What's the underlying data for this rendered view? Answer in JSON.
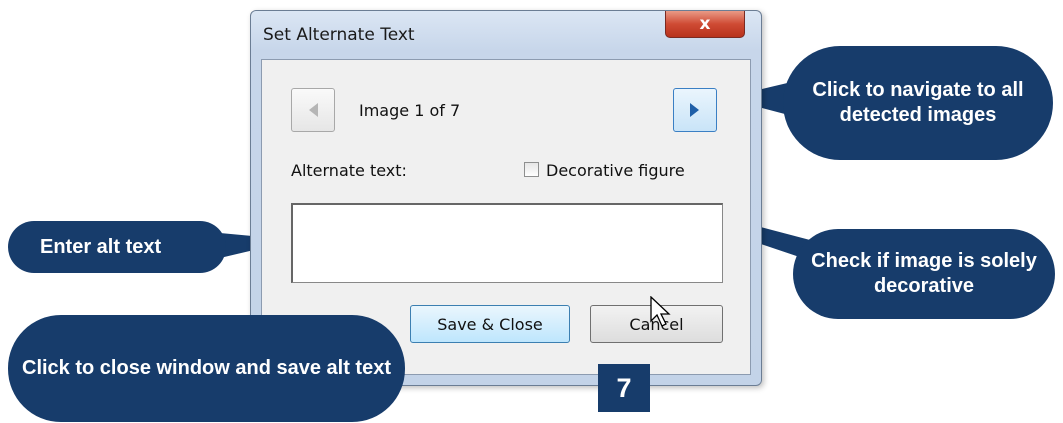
{
  "dialog": {
    "title": "Set Alternate Text",
    "close_label": "x",
    "image_counter": "Image 1 of 7",
    "alt_text_label": "Alternate text:",
    "alt_text_value": "",
    "decorative_label": "Decorative figure",
    "decorative_checked": false,
    "save_label": "Save & Close",
    "cancel_label": "Cancel"
  },
  "callouts": {
    "navigate": "Click to navigate to all detected images",
    "enter": "Enter alt text",
    "decorative": "Check if image is solely decorative",
    "save": "Click to close window and save alt text"
  },
  "step_number": "7",
  "colors": {
    "callout": "#173c6b",
    "close_button": "#c9432d"
  },
  "icons": [
    "close-icon",
    "arrow-left-icon",
    "arrow-right-icon",
    "mouse-cursor-icon"
  ]
}
